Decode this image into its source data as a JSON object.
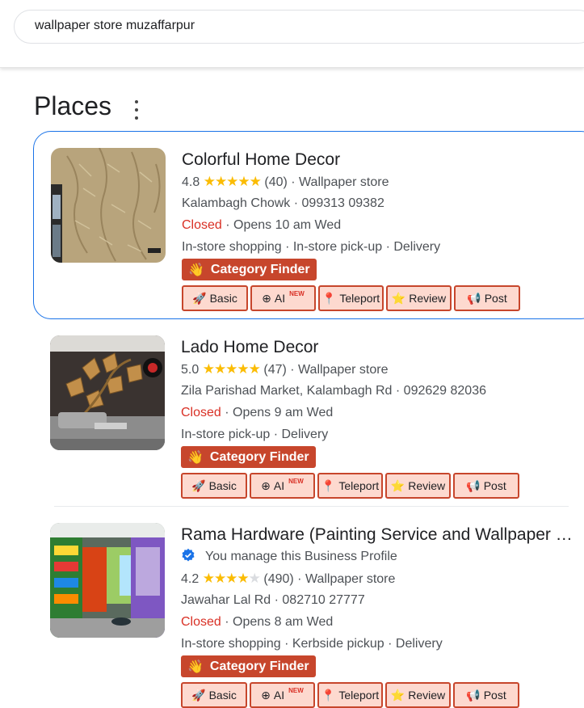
{
  "search": {
    "query": "wallpaper store muzaffarpur"
  },
  "section": {
    "title": "Places"
  },
  "tool_buttons": {
    "basic": "Basic",
    "ai": "AI",
    "ai_badge": "NEW",
    "teleport": "Teleport",
    "review": "Review",
    "post": "Post"
  },
  "category_finder_label": "Category Finder",
  "places": [
    {
      "name": "Colorful Home Decor",
      "rating": "4.8",
      "stars": 5,
      "reviews": "(40)",
      "category": "Wallpaper store",
      "address": "Kalambagh Chowk",
      "phone": "099313 09382",
      "status": "Closed",
      "hours": "Opens 10 am Wed",
      "services": "In-store shopping · In-store pick-up · Delivery"
    },
    {
      "name": "Lado Home Decor",
      "rating": "5.0",
      "stars": 5,
      "reviews": "(47)",
      "category": "Wallpaper store",
      "address": "Zila Parishad Market, Kalambagh Rd",
      "phone": "092629 82036",
      "status": "Closed",
      "hours": "Opens 9 am Wed",
      "services": "In-store pick-up · Delivery"
    },
    {
      "name": "Rama Hardware (Painting Service and Wallpaper Store)",
      "managed": "You manage this Business Profile",
      "rating": "4.2",
      "stars": 4,
      "reviews": "(490)",
      "category": "Wallpaper store",
      "address": "Jawahar Lal Rd",
      "phone": "082710 27777",
      "status": "Closed",
      "hours": "Opens 8 am Wed",
      "services": "In-store shopping · Kerbside pickup · Delivery"
    }
  ],
  "colors": {
    "accent_blue": "#1a73e8",
    "closed_red": "#d93025",
    "star_yellow": "#fbbc04",
    "finder_bg": "#c7462c",
    "tool_bg": "#fdd9cf"
  }
}
